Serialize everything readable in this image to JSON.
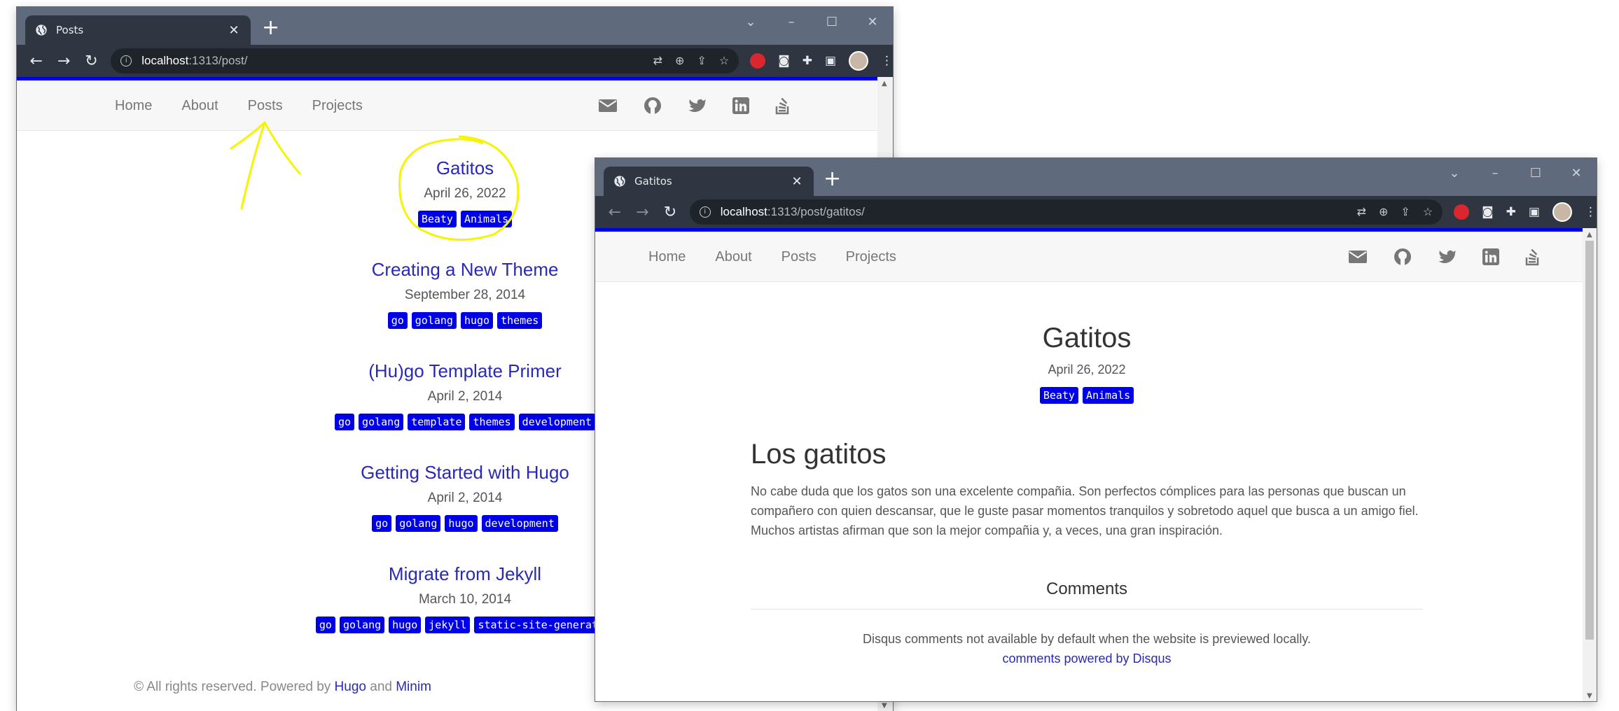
{
  "window1": {
    "tab_title": "Posts",
    "url_host": "localhost",
    "url_path": ":1313/post/",
    "nav": [
      "Home",
      "About",
      "Posts",
      "Projects"
    ],
    "posts": [
      {
        "title": "Gatitos",
        "date": "April 26, 2022",
        "tags": [
          "Beaty",
          "Animals"
        ]
      },
      {
        "title": "Creating a New Theme",
        "date": "September 28, 2014",
        "tags": [
          "go",
          "golang",
          "hugo",
          "themes"
        ]
      },
      {
        "title": "(Hu)go Template Primer",
        "date": "April 2, 2014",
        "tags": [
          "go",
          "golang",
          "template",
          "themes",
          "development"
        ]
      },
      {
        "title": "Getting Started with Hugo",
        "date": "April 2, 2014",
        "tags": [
          "go",
          "golang",
          "hugo",
          "development"
        ]
      },
      {
        "title": "Migrate from Jekyll",
        "date": "March 10, 2014",
        "tags": [
          "go",
          "golang",
          "hugo",
          "jekyll",
          "static-site-generator"
        ]
      }
    ],
    "footer_prefix": "© All rights reserved. Powered by",
    "footer_hugo": "Hugo",
    "footer_and": "and",
    "footer_minimal": "Minim"
  },
  "window2": {
    "tab_title": "Gatitos",
    "url_host": "localhost",
    "url_path": ":1313/post/gatitos/",
    "nav": [
      "Home",
      "About",
      "Posts",
      "Projects"
    ],
    "title": "Gatitos",
    "date": "April 26, 2022",
    "tags": [
      "Beaty",
      "Animals"
    ],
    "heading": "Los gatitos",
    "body": "No cabe duda que los gatos son una excelente compañia. Son perfectos cómplices para las personas que buscan un compañero con quien descansar, que le guste pasar momentos tranquilos y sobretodo aquel que busca a un amigo fiel. Muchos artistas afirman que son la mejor compañia y, a veces, una gran inspiración.",
    "comments_heading": "Comments",
    "disqus_note": "Disqus comments not available by default when the website is previewed locally.",
    "disqus_link": "comments powered by Disqus"
  },
  "colors": {
    "accent": "#0000e6",
    "link": "#2929b8",
    "annotation": "#f5f500"
  }
}
